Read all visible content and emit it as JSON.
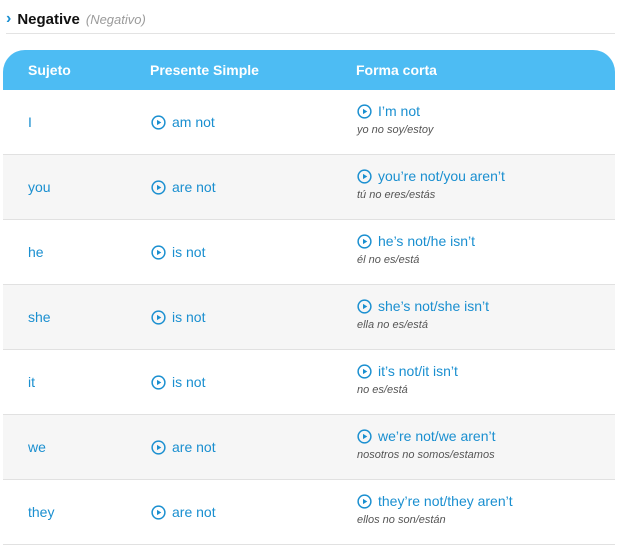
{
  "section": {
    "title": "Negative",
    "subtitle": "(Negativo)"
  },
  "table": {
    "headers": {
      "subject": "Sujeto",
      "present": "Presente Simple",
      "short": "Forma corta"
    },
    "rows": [
      {
        "subject": "I",
        "present": "am not",
        "short": "I’m not",
        "translation": "yo no soy/estoy"
      },
      {
        "subject": "you",
        "present": "are not",
        "short": "you’re not/you aren’t",
        "translation": "tú no eres/estás"
      },
      {
        "subject": "he",
        "present": "is not",
        "short": "he’s not/he isn’t",
        "translation": "él no es/está"
      },
      {
        "subject": "she",
        "present": "is not",
        "short": "she’s not/she isn’t",
        "translation": "ella no es/está"
      },
      {
        "subject": "it",
        "present": "is not",
        "short": "it’s not/it isn’t",
        "translation": "no es/está"
      },
      {
        "subject": "we",
        "present": "are not",
        "short": "we’re not/we aren’t",
        "translation": "nosotros no somos/estamos"
      },
      {
        "subject": "they",
        "present": "are not",
        "short": "they’re not/they aren’t",
        "translation": "ellos no son/están"
      }
    ]
  },
  "colors": {
    "header_bg": "#4dbcf3",
    "link": "#1a8fd0",
    "row_alt": "#f6f6f6"
  },
  "icons": {
    "section_toggle": "chevron-right-icon",
    "audio": "play-circle-icon"
  }
}
